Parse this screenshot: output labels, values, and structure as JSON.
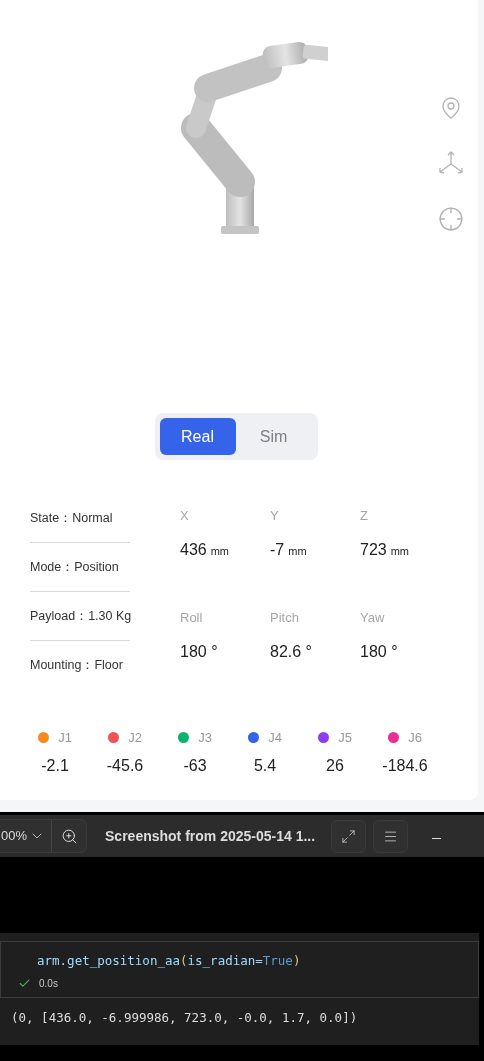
{
  "viewer": {
    "mode_tabs": [
      {
        "label": "Real",
        "selected": true
      },
      {
        "label": "Sim",
        "selected": false
      }
    ]
  },
  "status": [
    "State：Normal",
    "Mode：Position",
    "Payload：1.30 Kg",
    "Mounting：Floor"
  ],
  "pose": [
    {
      "label": "X",
      "value": "436",
      "unit": "mm"
    },
    {
      "label": "Y",
      "value": "-7",
      "unit": "mm"
    },
    {
      "label": "Z",
      "value": "723",
      "unit": "mm"
    },
    {
      "label": "Roll",
      "value": "180 °"
    },
    {
      "label": "Pitch",
      "value": "82.6 °"
    },
    {
      "label": "Yaw",
      "value": "180 °"
    }
  ],
  "joints": [
    {
      "label": "J1",
      "value": "-2.1",
      "color": "#f7891f"
    },
    {
      "label": "J2",
      "value": "-45.6",
      "color": "#f25252"
    },
    {
      "label": "J3",
      "value": "-63",
      "color": "#0bb26f"
    },
    {
      "label": "J4",
      "value": "5.4",
      "color": "#3563e9"
    },
    {
      "label": "J5",
      "value": "26",
      "color": "#8f3cf5"
    },
    {
      "label": "J6",
      "value": "-184.6",
      "color": "#ea2e94"
    }
  ],
  "image_viewer": {
    "zoom": "00%",
    "title": "Screenshot from 2025-05-14 1..."
  },
  "notebook_cell": {
    "code": [
      {
        "text": "arm.get_position_aa",
        "kind": "name"
      },
      {
        "text": "(",
        "kind": "paren"
      },
      {
        "text": "is_radian=",
        "kind": "name"
      },
      {
        "text": "True",
        "kind": "keyword"
      },
      {
        "text": ")",
        "kind": "paren"
      }
    ],
    "duration": "0.0s",
    "output": "(0, [436.0, -6.999986, 723.0, -0.0, 1.7, 0.0])"
  }
}
